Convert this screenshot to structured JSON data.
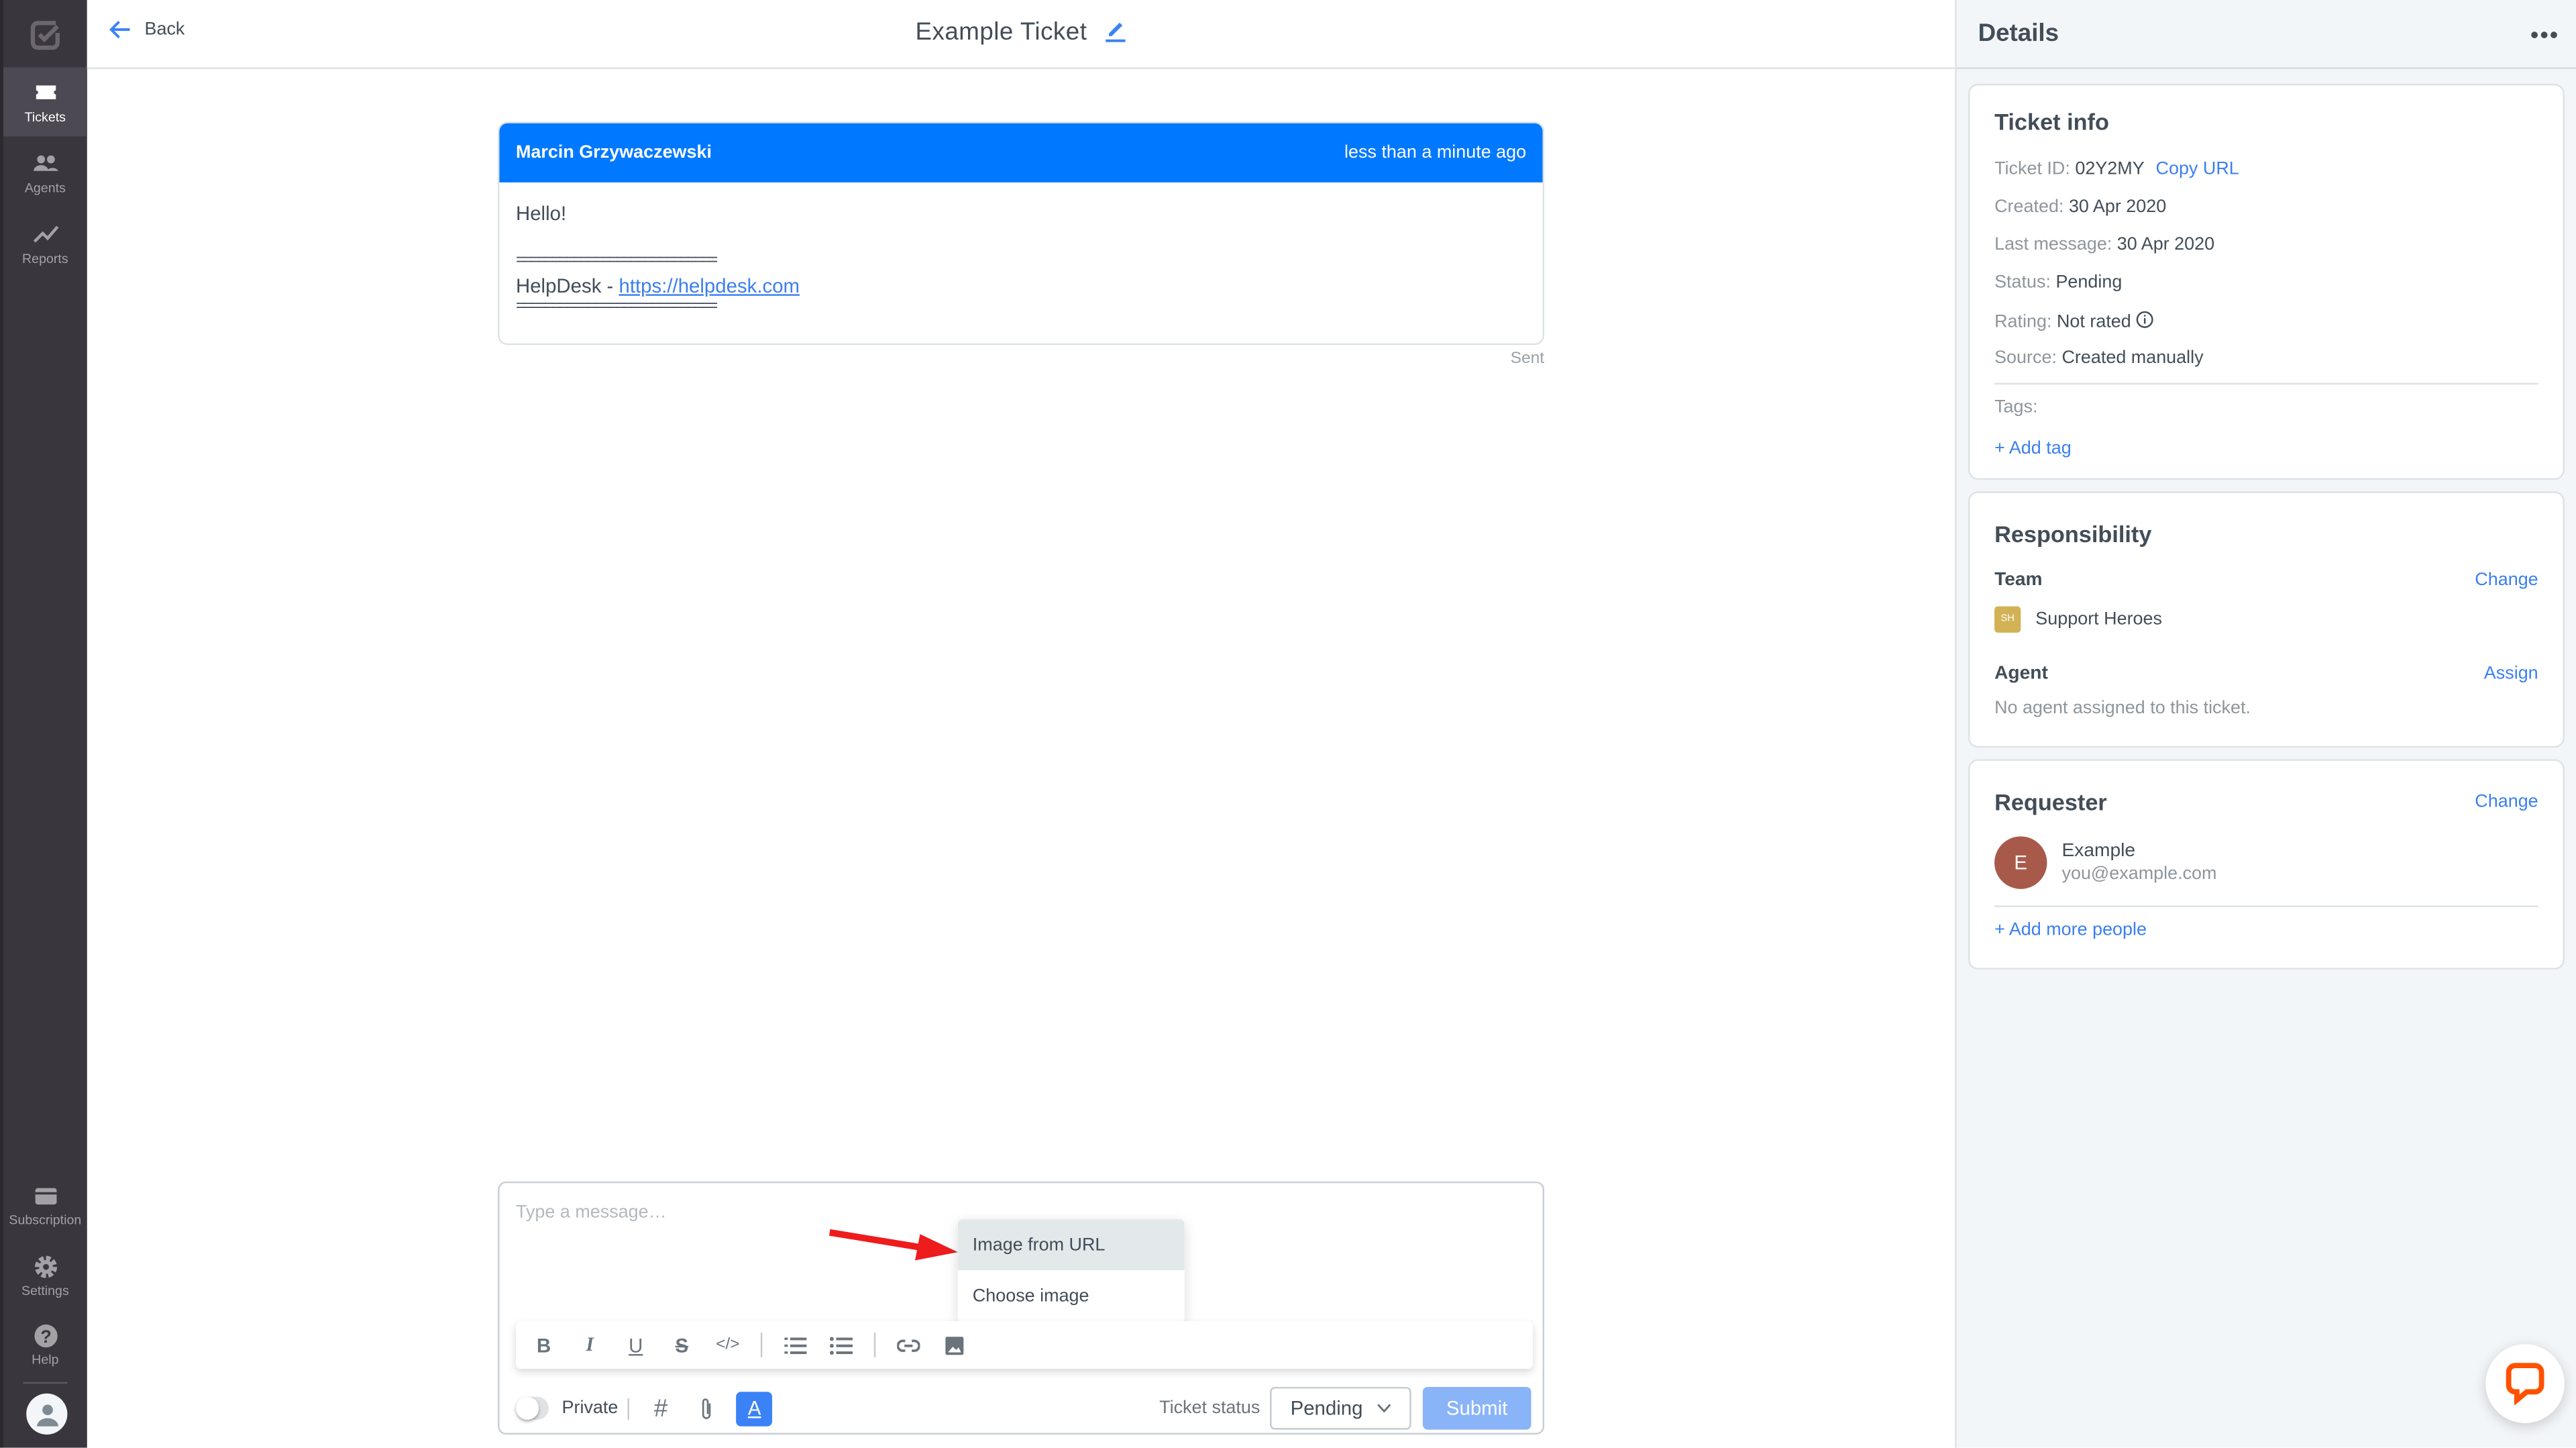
{
  "sidebar": {
    "logo": "helpdesk-logo",
    "items": [
      {
        "label": "Tickets",
        "icon": "ticket-icon",
        "active": true
      },
      {
        "label": "Agents",
        "icon": "agents-icon"
      },
      {
        "label": "Reports",
        "icon": "reports-icon"
      }
    ],
    "bottom_items": [
      {
        "label": "Subscription",
        "icon": "card-icon"
      },
      {
        "label": "Settings",
        "icon": "gear-icon"
      },
      {
        "label": "Help",
        "icon": "help-icon"
      }
    ]
  },
  "header": {
    "back_label": "Back",
    "title": "Example Ticket"
  },
  "message": {
    "author": "Marcin Grzywaczewski",
    "time": "less than a minute ago",
    "greeting": "Hello!",
    "separator": "============================",
    "signature_prefix": "HelpDesk - ",
    "signature_link": "https://helpdesk.com",
    "status": "Sent"
  },
  "composer": {
    "placeholder": "Type a message…",
    "image_menu": [
      {
        "label": "Image from URL",
        "highlighted": true
      },
      {
        "label": "Choose image"
      }
    ],
    "toolbar": {
      "bold": "B",
      "italic": "I",
      "underline": "U",
      "strike": "S",
      "code": "</>"
    },
    "private_label": "Private",
    "hash": "#",
    "font_button": "A",
    "ticket_status_label": "Ticket status",
    "ticket_status_value": "Pending",
    "submit_label": "Submit"
  },
  "details": {
    "title": "Details",
    "menu": "•••",
    "ticket_info": {
      "title": "Ticket info",
      "ticket_id_label": "Ticket ID:",
      "ticket_id": "02Y2MY",
      "copy_url": "Copy URL",
      "created_label": "Created:",
      "created": "30 Apr 2020",
      "last_message_label": "Last message:",
      "last_message": "30 Apr 2020",
      "status_label": "Status:",
      "status": "Pending",
      "rating_label": "Rating:",
      "rating": "Not rated",
      "source_label": "Source:",
      "source": "Created manually",
      "tags_label": "Tags:",
      "add_tag": "+ Add tag"
    },
    "responsibility": {
      "title": "Responsibility",
      "team_label": "Team",
      "team_change": "Change",
      "team_initials": "SH",
      "team_name": "Support Heroes",
      "team_color": "#d3b255",
      "agent_label": "Agent",
      "agent_assign": "Assign",
      "agent_empty": "No agent assigned to this ticket."
    },
    "requester": {
      "title": "Requester",
      "change": "Change",
      "initial": "E",
      "name": "Example",
      "email": "you@example.com",
      "avatar_color": "#a85a4a",
      "add_people": "+ Add more people"
    }
  },
  "colors": {
    "accent": "#0078ff",
    "link": "#3b7ff0",
    "submit_disabled": "#8ab4f8",
    "sidebar": "#3a363d",
    "chat_widget": "#ff5100"
  }
}
